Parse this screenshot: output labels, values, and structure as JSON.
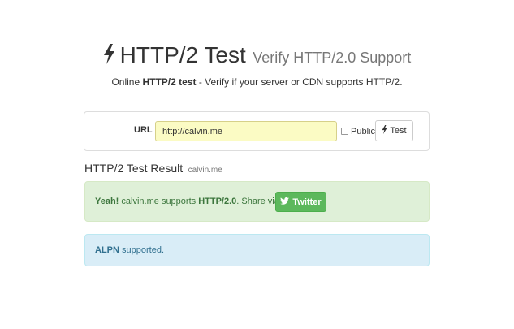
{
  "header": {
    "title": "HTTP/2 Test",
    "subtitle": "Verify HTTP/2.0 Support",
    "icon": "bolt-icon",
    "tagline_prefix": "Online",
    "tagline_bold": "HTTP/2 test",
    "tagline_suffix": "- Verify if your server or CDN supports HTTP/2."
  },
  "form": {
    "url_label": "URL",
    "url_value": "http://calvin.me",
    "public_label": "Public",
    "public_checked": false,
    "test_button_label": "Test",
    "test_button_icon": "bolt-icon"
  },
  "result": {
    "title": "HTTP/2 Test Result",
    "host": "calvin.me"
  },
  "success_alert": {
    "bold_prefix": "Yeah!",
    "text_middle": "calvin.me supports",
    "bold_protocol": "HTTP/2.0",
    "text_suffix": ". Share via:",
    "twitter_label": "Twitter",
    "twitter_icon": "twitter-icon"
  },
  "info_alert": {
    "bold_text": "ALPN",
    "text_suffix": "supported."
  },
  "colors": {
    "success_bg": "#dff0d8",
    "success_text": "#3c763d",
    "info_bg": "#d9edf7",
    "info_text": "#31708f",
    "twitter_button": "#5cb85c",
    "input_highlight": "#fbfbc4"
  }
}
